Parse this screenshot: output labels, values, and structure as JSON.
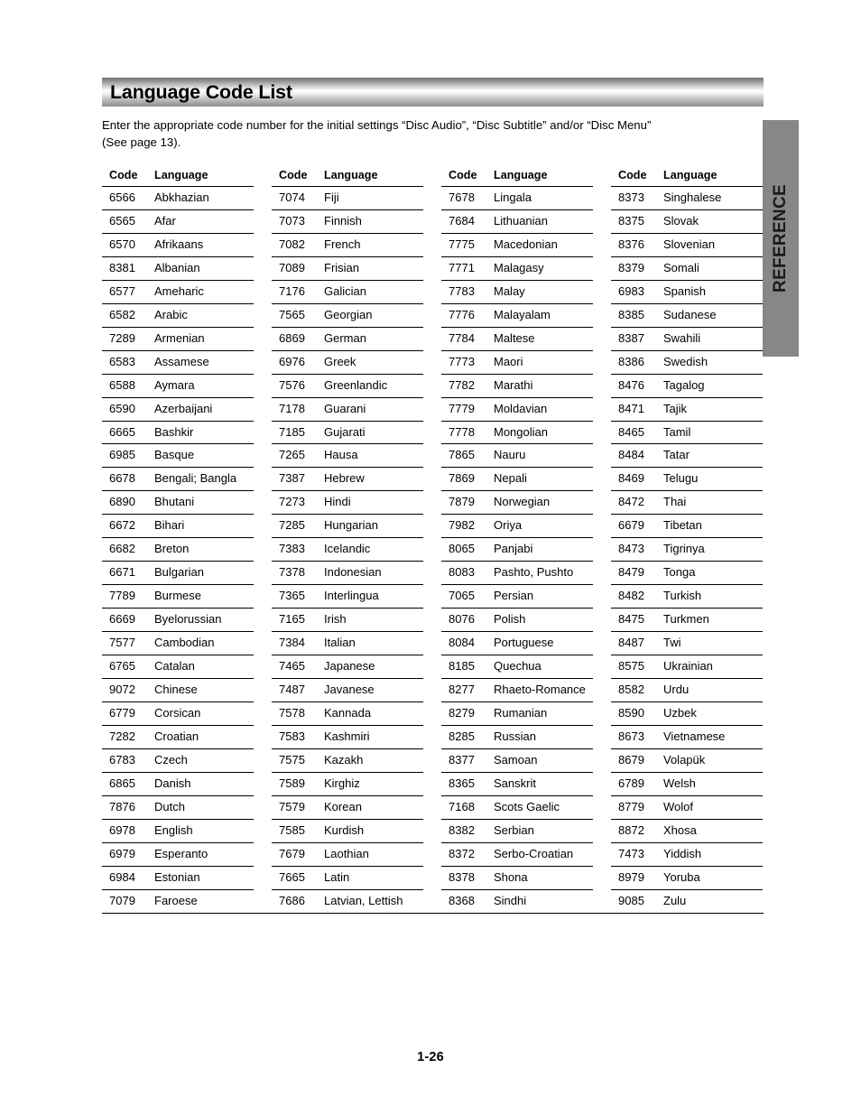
{
  "header": {
    "title": "Language Code List"
  },
  "intro": {
    "line1": "Enter the appropriate code number for the initial settings “Disc Audio”, “Disc Subtitle” and/or “Disc Menu”",
    "line2": "(See page 13)."
  },
  "side_tab": {
    "label": "REFERENCE",
    "background_color": "#878787"
  },
  "footer": {
    "page_number": "1-26"
  },
  "table": {
    "headers": {
      "code": "Code",
      "language": "Language"
    },
    "columns": [
      {
        "rows": [
          {
            "code": "6566",
            "language": "Abkhazian"
          },
          {
            "code": "6565",
            "language": "Afar"
          },
          {
            "code": "6570",
            "language": "Afrikaans"
          },
          {
            "code": "8381",
            "language": "Albanian"
          },
          {
            "code": "6577",
            "language": "Ameharic"
          },
          {
            "code": "6582",
            "language": "Arabic"
          },
          {
            "code": "7289",
            "language": "Armenian"
          },
          {
            "code": "6583",
            "language": "Assamese"
          },
          {
            "code": "6588",
            "language": "Aymara"
          },
          {
            "code": "6590",
            "language": "Azerbaijani"
          },
          {
            "code": "6665",
            "language": "Bashkir"
          },
          {
            "code": "6985",
            "language": "Basque"
          },
          {
            "code": "6678",
            "language": "Bengali; Bangla"
          },
          {
            "code": "6890",
            "language": "Bhutani"
          },
          {
            "code": "6672",
            "language": "Bihari"
          },
          {
            "code": "6682",
            "language": "Breton"
          },
          {
            "code": "6671",
            "language": "Bulgarian"
          },
          {
            "code": "7789",
            "language": "Burmese"
          },
          {
            "code": "6669",
            "language": "Byelorussian"
          },
          {
            "code": "7577",
            "language": "Cambodian"
          },
          {
            "code": "6765",
            "language": "Catalan"
          },
          {
            "code": "9072",
            "language": "Chinese"
          },
          {
            "code": "6779",
            "language": "Corsican"
          },
          {
            "code": "7282",
            "language": "Croatian"
          },
          {
            "code": "6783",
            "language": "Czech"
          },
          {
            "code": "6865",
            "language": "Danish"
          },
          {
            "code": "7876",
            "language": "Dutch"
          },
          {
            "code": "6978",
            "language": "English"
          },
          {
            "code": "6979",
            "language": "Esperanto"
          },
          {
            "code": "6984",
            "language": "Estonian"
          },
          {
            "code": "7079",
            "language": "Faroese"
          }
        ]
      },
      {
        "rows": [
          {
            "code": "7074",
            "language": "Fiji"
          },
          {
            "code": "7073",
            "language": "Finnish"
          },
          {
            "code": "7082",
            "language": "French"
          },
          {
            "code": "7089",
            "language": "Frisian"
          },
          {
            "code": "7176",
            "language": "Galician"
          },
          {
            "code": "7565",
            "language": "Georgian"
          },
          {
            "code": "6869",
            "language": "German"
          },
          {
            "code": "6976",
            "language": "Greek"
          },
          {
            "code": "7576",
            "language": "Greenlandic"
          },
          {
            "code": "7178",
            "language": "Guarani"
          },
          {
            "code": "7185",
            "language": "Gujarati"
          },
          {
            "code": "7265",
            "language": "Hausa"
          },
          {
            "code": "7387",
            "language": "Hebrew"
          },
          {
            "code": "7273",
            "language": "Hindi"
          },
          {
            "code": "7285",
            "language": "Hungarian"
          },
          {
            "code": "7383",
            "language": "Icelandic"
          },
          {
            "code": "7378",
            "language": "Indonesian"
          },
          {
            "code": "7365",
            "language": "Interlingua"
          },
          {
            "code": "7165",
            "language": "Irish"
          },
          {
            "code": "7384",
            "language": "Italian"
          },
          {
            "code": "7465",
            "language": "Japanese"
          },
          {
            "code": "7487",
            "language": "Javanese"
          },
          {
            "code": "7578",
            "language": "Kannada"
          },
          {
            "code": "7583",
            "language": "Kashmiri"
          },
          {
            "code": "7575",
            "language": "Kazakh"
          },
          {
            "code": "7589",
            "language": "Kirghiz"
          },
          {
            "code": "7579",
            "language": "Korean"
          },
          {
            "code": "7585",
            "language": "Kurdish"
          },
          {
            "code": "7679",
            "language": "Laothian"
          },
          {
            "code": "7665",
            "language": "Latin"
          },
          {
            "code": "7686",
            "language": "Latvian, Lettish"
          }
        ]
      },
      {
        "rows": [
          {
            "code": "7678",
            "language": "Lingala"
          },
          {
            "code": "7684",
            "language": "Lithuanian"
          },
          {
            "code": "7775",
            "language": "Macedonian"
          },
          {
            "code": "7771",
            "language": "Malagasy"
          },
          {
            "code": "7783",
            "language": "Malay"
          },
          {
            "code": "7776",
            "language": "Malayalam"
          },
          {
            "code": "7784",
            "language": "Maltese"
          },
          {
            "code": "7773",
            "language": "Maori"
          },
          {
            "code": "7782",
            "language": "Marathi"
          },
          {
            "code": "7779",
            "language": "Moldavian"
          },
          {
            "code": "7778",
            "language": "Mongolian"
          },
          {
            "code": "7865",
            "language": "Nauru"
          },
          {
            "code": "7869",
            "language": "Nepali"
          },
          {
            "code": "7879",
            "language": "Norwegian"
          },
          {
            "code": "7982",
            "language": "Oriya"
          },
          {
            "code": "8065",
            "language": "Panjabi"
          },
          {
            "code": "8083",
            "language": "Pashto, Pushto"
          },
          {
            "code": "7065",
            "language": "Persian"
          },
          {
            "code": "8076",
            "language": "Polish"
          },
          {
            "code": "8084",
            "language": "Portuguese"
          },
          {
            "code": "8185",
            "language": "Quechua"
          },
          {
            "code": "8277",
            "language": "Rhaeto-Romance"
          },
          {
            "code": "8279",
            "language": "Rumanian"
          },
          {
            "code": "8285",
            "language": "Russian"
          },
          {
            "code": "8377",
            "language": "Samoan"
          },
          {
            "code": "8365",
            "language": "Sanskrit"
          },
          {
            "code": "7168",
            "language": "Scots Gaelic"
          },
          {
            "code": "8382",
            "language": "Serbian"
          },
          {
            "code": "8372",
            "language": "Serbo-Croatian"
          },
          {
            "code": "8378",
            "language": "Shona"
          },
          {
            "code": "8368",
            "language": "Sindhi"
          }
        ]
      },
      {
        "rows": [
          {
            "code": "8373",
            "language": "Singhalese"
          },
          {
            "code": "8375",
            "language": "Slovak"
          },
          {
            "code": "8376",
            "language": "Slovenian"
          },
          {
            "code": "8379",
            "language": "Somali"
          },
          {
            "code": "6983",
            "language": "Spanish"
          },
          {
            "code": "8385",
            "language": "Sudanese"
          },
          {
            "code": "8387",
            "language": "Swahili"
          },
          {
            "code": "8386",
            "language": "Swedish"
          },
          {
            "code": "8476",
            "language": "Tagalog"
          },
          {
            "code": "8471",
            "language": "Tajik"
          },
          {
            "code": "8465",
            "language": "Tamil"
          },
          {
            "code": "8484",
            "language": "Tatar"
          },
          {
            "code": "8469",
            "language": "Telugu"
          },
          {
            "code": "8472",
            "language": "Thai"
          },
          {
            "code": "6679",
            "language": "Tibetan"
          },
          {
            "code": "8473",
            "language": "Tigrinya"
          },
          {
            "code": "8479",
            "language": "Tonga"
          },
          {
            "code": "8482",
            "language": "Turkish"
          },
          {
            "code": "8475",
            "language": "Turkmen"
          },
          {
            "code": "8487",
            "language": "Twi"
          },
          {
            "code": "8575",
            "language": "Ukrainian"
          },
          {
            "code": "8582",
            "language": "Urdu"
          },
          {
            "code": "8590",
            "language": "Uzbek"
          },
          {
            "code": "8673",
            "language": "Vietnamese"
          },
          {
            "code": "8679",
            "language": "Volapük"
          },
          {
            "code": "6789",
            "language": "Welsh"
          },
          {
            "code": "8779",
            "language": "Wolof"
          },
          {
            "code": "8872",
            "language": "Xhosa"
          },
          {
            "code": "7473",
            "language": "Yiddish"
          },
          {
            "code": "8979",
            "language": "Yoruba"
          },
          {
            "code": "9085",
            "language": "Zulu"
          }
        ]
      }
    ]
  }
}
